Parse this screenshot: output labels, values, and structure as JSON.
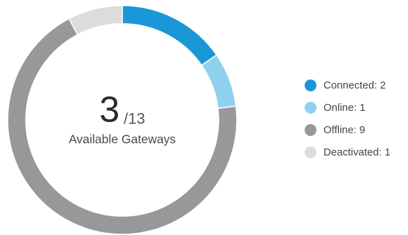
{
  "chart_data": {
    "type": "pie",
    "variant": "donut",
    "title": "",
    "center": {
      "value": "3",
      "total": "/13",
      "caption": "Available Gateways"
    },
    "categories": [
      "Connected",
      "Online",
      "Offline",
      "Deactivated"
    ],
    "values": [
      2,
      1,
      9,
      1
    ],
    "colors": [
      "#1a97d6",
      "#8fd1ee",
      "#989898",
      "#dcdcdc"
    ],
    "legend_position": "right",
    "legend": [
      {
        "label": "Connected: 2",
        "color": "#1a97d6"
      },
      {
        "label": "Online: 1",
        "color": "#8fd1ee"
      },
      {
        "label": "Offline: 9",
        "color": "#989898"
      },
      {
        "label": "Deactivated: 1",
        "color": "#dcdcdc"
      }
    ]
  }
}
